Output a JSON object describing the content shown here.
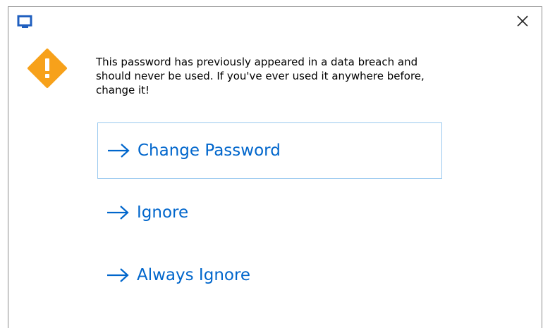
{
  "dialog": {
    "message_lines": [
      "This password has previously appeared in a data breach and",
      "should never be used. If you've ever used it anywhere before,",
      "change it!"
    ],
    "icons": {
      "window": "app-window-icon",
      "close": "close-icon",
      "warning": "warning-icon",
      "arrow": "arrow-right-icon"
    },
    "colors": {
      "accent": "#0066cc",
      "warning": "#f7a11a",
      "default_border": "#99c9ef"
    },
    "commands": [
      {
        "label": "Change Password",
        "default": true
      },
      {
        "label": "Ignore",
        "default": false
      },
      {
        "label": "Always Ignore",
        "default": false
      }
    ]
  }
}
